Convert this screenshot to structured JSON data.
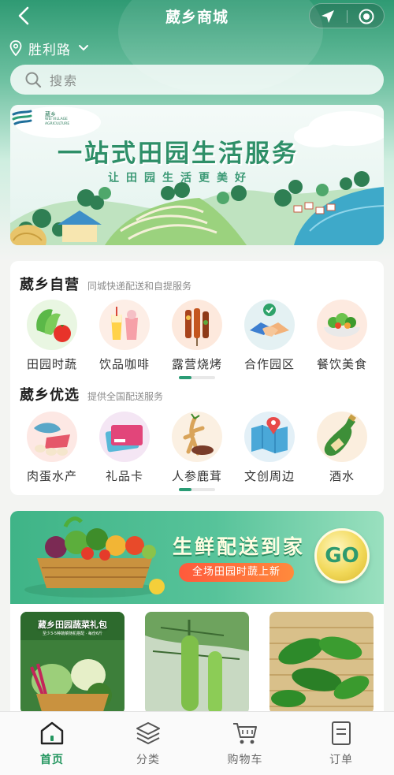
{
  "header": {
    "title": "葳乡商城",
    "location": "胜利路",
    "search_placeholder": "搜索"
  },
  "banner": {
    "title": "一站式田园生活服务",
    "subtitle": "让田园生活更美好",
    "logo_cn": "葳乡",
    "logo_en": "WEI VILLAGE AGRICULTURE"
  },
  "sections": {
    "self_run": {
      "title": "葳乡自营",
      "subtitle": "同城快递配送和自提服务",
      "items": [
        {
          "label": "田园时蔬",
          "icon": "vegetables-icon"
        },
        {
          "label": "饮品咖啡",
          "icon": "drinks-coffee-icon"
        },
        {
          "label": "露营烧烤",
          "icon": "bbq-icon"
        },
        {
          "label": "合作园区",
          "icon": "handshake-icon"
        },
        {
          "label": "餐饮美食",
          "icon": "salad-bowl-icon"
        }
      ]
    },
    "selected": {
      "title": "葳乡优选",
      "subtitle": "提供全国配送服务",
      "items": [
        {
          "label": "肉蛋水产",
          "icon": "meat-eggs-fish-icon"
        },
        {
          "label": "礼品卡",
          "icon": "gift-card-icon"
        },
        {
          "label": "人参鹿茸",
          "icon": "ginseng-icon"
        },
        {
          "label": "文创周边",
          "icon": "map-pin-icon"
        },
        {
          "label": "酒水",
          "icon": "wine-bottle-icon"
        }
      ]
    }
  },
  "promo": {
    "title": "生鲜配送到家",
    "pill": "全场田园时蔬上新",
    "go": "GO"
  },
  "products": [
    {
      "title": "葳乡田园蔬菜礼包",
      "subtitle": "至少3-5种蔬菜随机搭配 · 每份6斤"
    },
    {
      "title": "",
      "subtitle": ""
    },
    {
      "title": "",
      "subtitle": ""
    }
  ],
  "tabs": [
    {
      "label": "首页",
      "icon": "home-icon",
      "active": true
    },
    {
      "label": "分类",
      "icon": "layers-icon",
      "active": false
    },
    {
      "label": "购物车",
      "icon": "cart-icon",
      "active": false
    },
    {
      "label": "订单",
      "icon": "order-list-icon",
      "active": false
    }
  ],
  "colors": {
    "brand_green": "#2a9c75",
    "active_tab": "#23965f",
    "promo_pill": "#ff5a3c"
  }
}
